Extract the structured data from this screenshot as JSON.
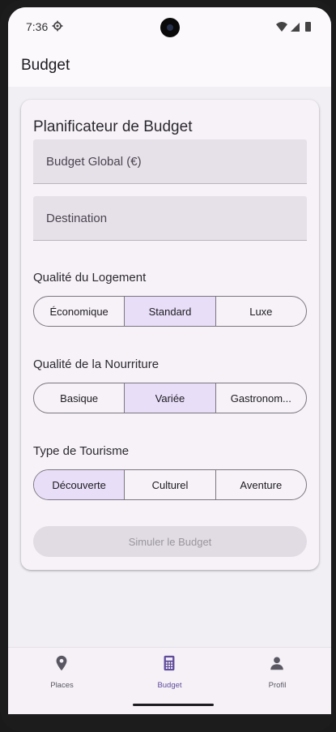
{
  "status_bar": {
    "time": "7:36",
    "icons": [
      "gear-icon",
      "wifi-icon",
      "signal-icon",
      "battery-icon"
    ]
  },
  "app_bar": {
    "title": "Budget"
  },
  "card": {
    "title": "Planificateur de Budget",
    "fields": {
      "budget_placeholder": "Budget Global (€)",
      "budget_value": "",
      "destination_placeholder": "Destination",
      "destination_value": ""
    },
    "logement": {
      "label": "Qualité du Logement",
      "options": [
        "Économique",
        "Standard",
        "Luxe"
      ],
      "selected": "Standard"
    },
    "nourriture": {
      "label": "Qualité de la Nourriture",
      "options": [
        "Basique",
        "Variée",
        "Gastronom..."
      ],
      "selected": "Variée"
    },
    "tourisme": {
      "label": "Type de Tourisme",
      "options": [
        "Découverte",
        "Culturel",
        "Aventure"
      ],
      "selected": "Découverte"
    },
    "simulate_label": "Simuler le Budget"
  },
  "bottom_nav": {
    "items": [
      {
        "label": "Places",
        "icon": "location-pin-icon"
      },
      {
        "label": "Budget",
        "icon": "calculator-icon"
      },
      {
        "label": "Profil",
        "icon": "person-icon"
      }
    ],
    "active": "Budget"
  },
  "colors": {
    "accent": "#5f4b9a",
    "selected_segment": "#e8def8",
    "field_bg": "#e6e0e9",
    "disabled_button": "#e1dce3"
  }
}
